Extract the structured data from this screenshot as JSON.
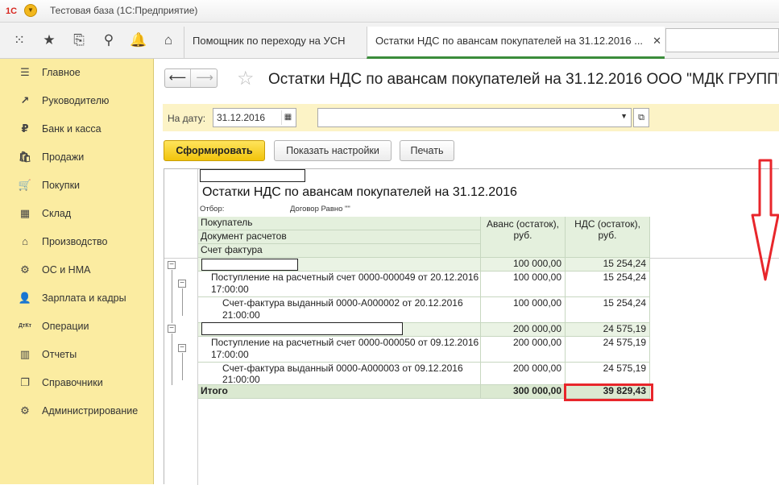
{
  "app": {
    "logo": "1С",
    "title": "Тестовая база  (1С:Предприятие)"
  },
  "tabs": [
    {
      "label": "Помощник по переходу на УСН"
    },
    {
      "label": "Остатки НДС по авансам покупателей на 31.12.2016 ..."
    }
  ],
  "sidebar": {
    "items": [
      {
        "label": "Главное",
        "icon": "☰"
      },
      {
        "label": "Руководителю",
        "icon": "↗"
      },
      {
        "label": "Банк и касса",
        "icon": "₽"
      },
      {
        "label": "Продажи",
        "icon": "🛍"
      },
      {
        "label": "Покупки",
        "icon": "🛒"
      },
      {
        "label": "Склад",
        "icon": "▦"
      },
      {
        "label": "Производство",
        "icon": "⌂"
      },
      {
        "label": "ОС и НМА",
        "icon": "⚙"
      },
      {
        "label": "Зарплата и кадры",
        "icon": "👤"
      },
      {
        "label": "Операции",
        "icon": "ДтКт"
      },
      {
        "label": "Отчеты",
        "icon": "▥"
      },
      {
        "label": "Справочники",
        "icon": "❐"
      },
      {
        "label": "Администрирование",
        "icon": "⚙"
      }
    ]
  },
  "page": {
    "title": "Остатки НДС по авансам покупателей на 31.12.2016 ООО \"МДК ГРУПП\""
  },
  "filter": {
    "date_label": "На дату:",
    "date_value": "31.12.2016"
  },
  "buttons": {
    "generate": "Сформировать",
    "settings": "Показать настройки",
    "print": "Печать"
  },
  "report": {
    "title": "Остатки НДС по авансам покупателей на 31.12.2016",
    "filter_label": "Отбор:",
    "filter_value": "Договор Равно \"\"",
    "headers": {
      "buyer": "Покупатель",
      "doc": "Документ расчетов",
      "invoice": "Счет фактура",
      "advance": "Аванс (остаток), руб.",
      "vat": "НДС (остаток), руб."
    },
    "rows": [
      {
        "type": "group",
        "label": "",
        "advance": "100 000,00",
        "vat": "15 254,24"
      },
      {
        "type": "doc",
        "label": "Поступление на расчетный счет 0000-000049 от 20.12.2016 17:00:00",
        "advance": "100 000,00",
        "vat": "15 254,24"
      },
      {
        "type": "invoice",
        "label": "Счет-фактура выданный 0000-А000002 от 20.12.2016 21:00:00",
        "advance": "100 000,00",
        "vat": "15 254,24"
      },
      {
        "type": "group",
        "label": "",
        "advance": "200 000,00",
        "vat": "24 575,19"
      },
      {
        "type": "doc",
        "label": "Поступление на расчетный счет 0000-000050 от 09.12.2016 17:00:00",
        "advance": "200 000,00",
        "vat": "24 575,19"
      },
      {
        "type": "invoice",
        "label": "Счет-фактура выданный 0000-А000003 от 09.12.2016 21:00:00",
        "advance": "200 000,00",
        "vat": "24 575,19"
      }
    ],
    "total": {
      "label": "Итого",
      "advance": "300 000,00",
      "vat": "39 829,43"
    }
  },
  "colors": {
    "sidebar_bg": "#fbeca1",
    "primary_button": "#f1c40b",
    "highlight": "#e8262b",
    "table_header": "#e4f0dd"
  }
}
